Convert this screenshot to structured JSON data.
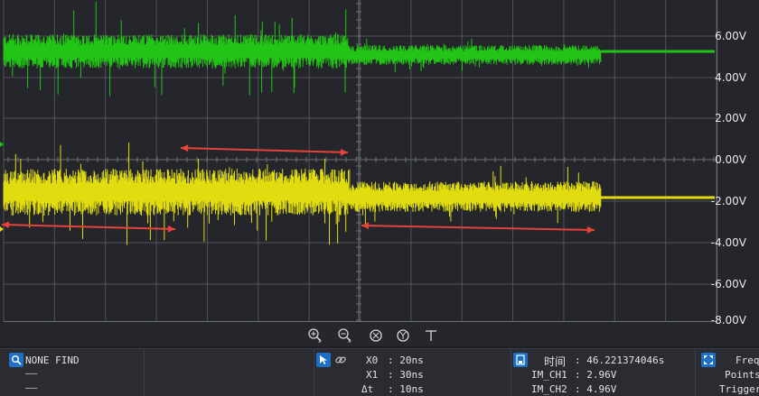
{
  "scope": {
    "y_axis": {
      "ticks": [
        "6.00V",
        "4.00V",
        "2.00V",
        "0.00V",
        "-2.00V",
        "-4.00V",
        "-6.00V",
        "-8.00V"
      ]
    },
    "channel_colors": {
      "ch1": "#22c415",
      "ch2": "#e0dc10",
      "marker": "#e8433b"
    }
  },
  "zoom_bar": {
    "buttons": [
      "zoom-in-x-icon",
      "zoom-out-x-icon",
      "zoom-fit-x-icon",
      "zoom-fit-y-icon",
      "cursor-t-icon"
    ]
  },
  "bottom": {
    "search_result": "NONE FIND",
    "list_rows": [
      "——",
      "——"
    ],
    "cursors": {
      "x0_label": "X0",
      "x0_value": ": 20ns",
      "x1_label": "X1",
      "x1_value": ": 30ns",
      "dt_label": "Δt",
      "dt_value": ": 10ns"
    },
    "measure": {
      "time_label": "时间",
      "time_value": ": 46.221374046s",
      "ch1_label": "IM_CH1",
      "ch1_value": ": 2.96V",
      "ch2_label": "IM_CH2",
      "ch2_value": ": 4.96V"
    },
    "right": {
      "line1": "Freq",
      "line2": "Points",
      "line3": "Trigger"
    }
  }
}
